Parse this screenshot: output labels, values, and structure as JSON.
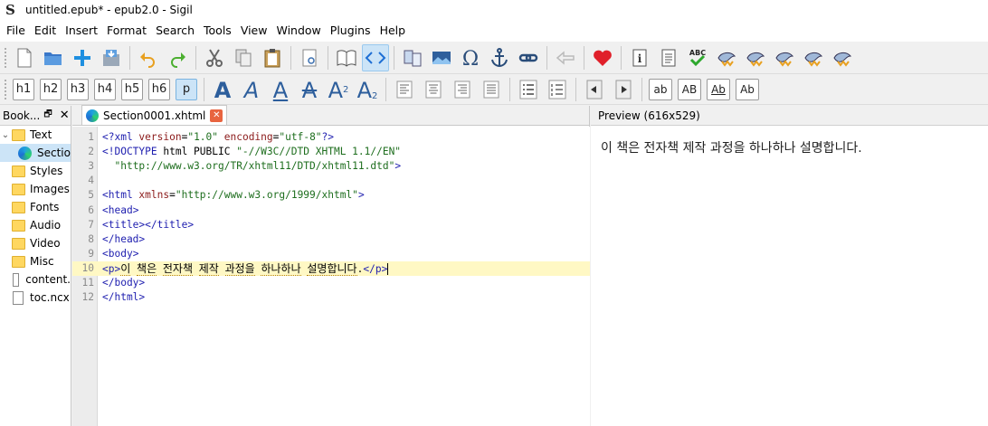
{
  "window": {
    "title": "untitled.epub* - epub2.0 - Sigil"
  },
  "menu": [
    "File",
    "Edit",
    "Insert",
    "Format",
    "Search",
    "Tools",
    "View",
    "Window",
    "Plugins",
    "Help"
  ],
  "heading_buttons": [
    "h1",
    "h2",
    "h3",
    "h4",
    "h5",
    "h6",
    "p"
  ],
  "case_buttons": [
    "ab",
    "AB",
    "Ab",
    "Ab"
  ],
  "book_browser": {
    "title": "Book...",
    "items": [
      {
        "label": "Text",
        "type": "folder",
        "expanded": true
      },
      {
        "label": "Section0001.xhtml",
        "display": "Sectio",
        "type": "html",
        "selected": true
      },
      {
        "label": "Styles",
        "type": "folder"
      },
      {
        "label": "Images",
        "type": "folder"
      },
      {
        "label": "Fonts",
        "type": "folder"
      },
      {
        "label": "Audio",
        "type": "folder"
      },
      {
        "label": "Video",
        "type": "folder"
      },
      {
        "label": "Misc",
        "type": "folder"
      },
      {
        "label": "content.",
        "type": "file"
      },
      {
        "label": "toc.ncx",
        "type": "file"
      }
    ]
  },
  "editor": {
    "tab_label": "Section0001.xhtml",
    "current_line": 10,
    "lines": [
      "<?xml version=\"1.0\" encoding=\"utf-8\"?>",
      "<!DOCTYPE html PUBLIC \"-//W3C//DTD XHTML 1.1//EN\"",
      "  \"http://www.w3.org/TR/xhtml11/DTD/xhtml11.dtd\">",
      "",
      "<html xmlns=\"http://www.w3.org/1999/xhtml\">",
      "<head>",
      "<title></title>",
      "</head>",
      "<body>",
      "<p>이 책은 전자책 제작 과정을 하나하나 설명합니다.</p>",
      "</body>",
      "</html>"
    ]
  },
  "preview": {
    "title": "Preview (616x529)",
    "text": "이 책은 전자책 제작 과정을 하나하나 설명합니다."
  },
  "colors": {
    "tag": "#1e1eaf",
    "attribute": "#8b1a1a",
    "value": "#1e6e1e",
    "current_line": "#fff8c4",
    "selection": "#cce4f7"
  }
}
